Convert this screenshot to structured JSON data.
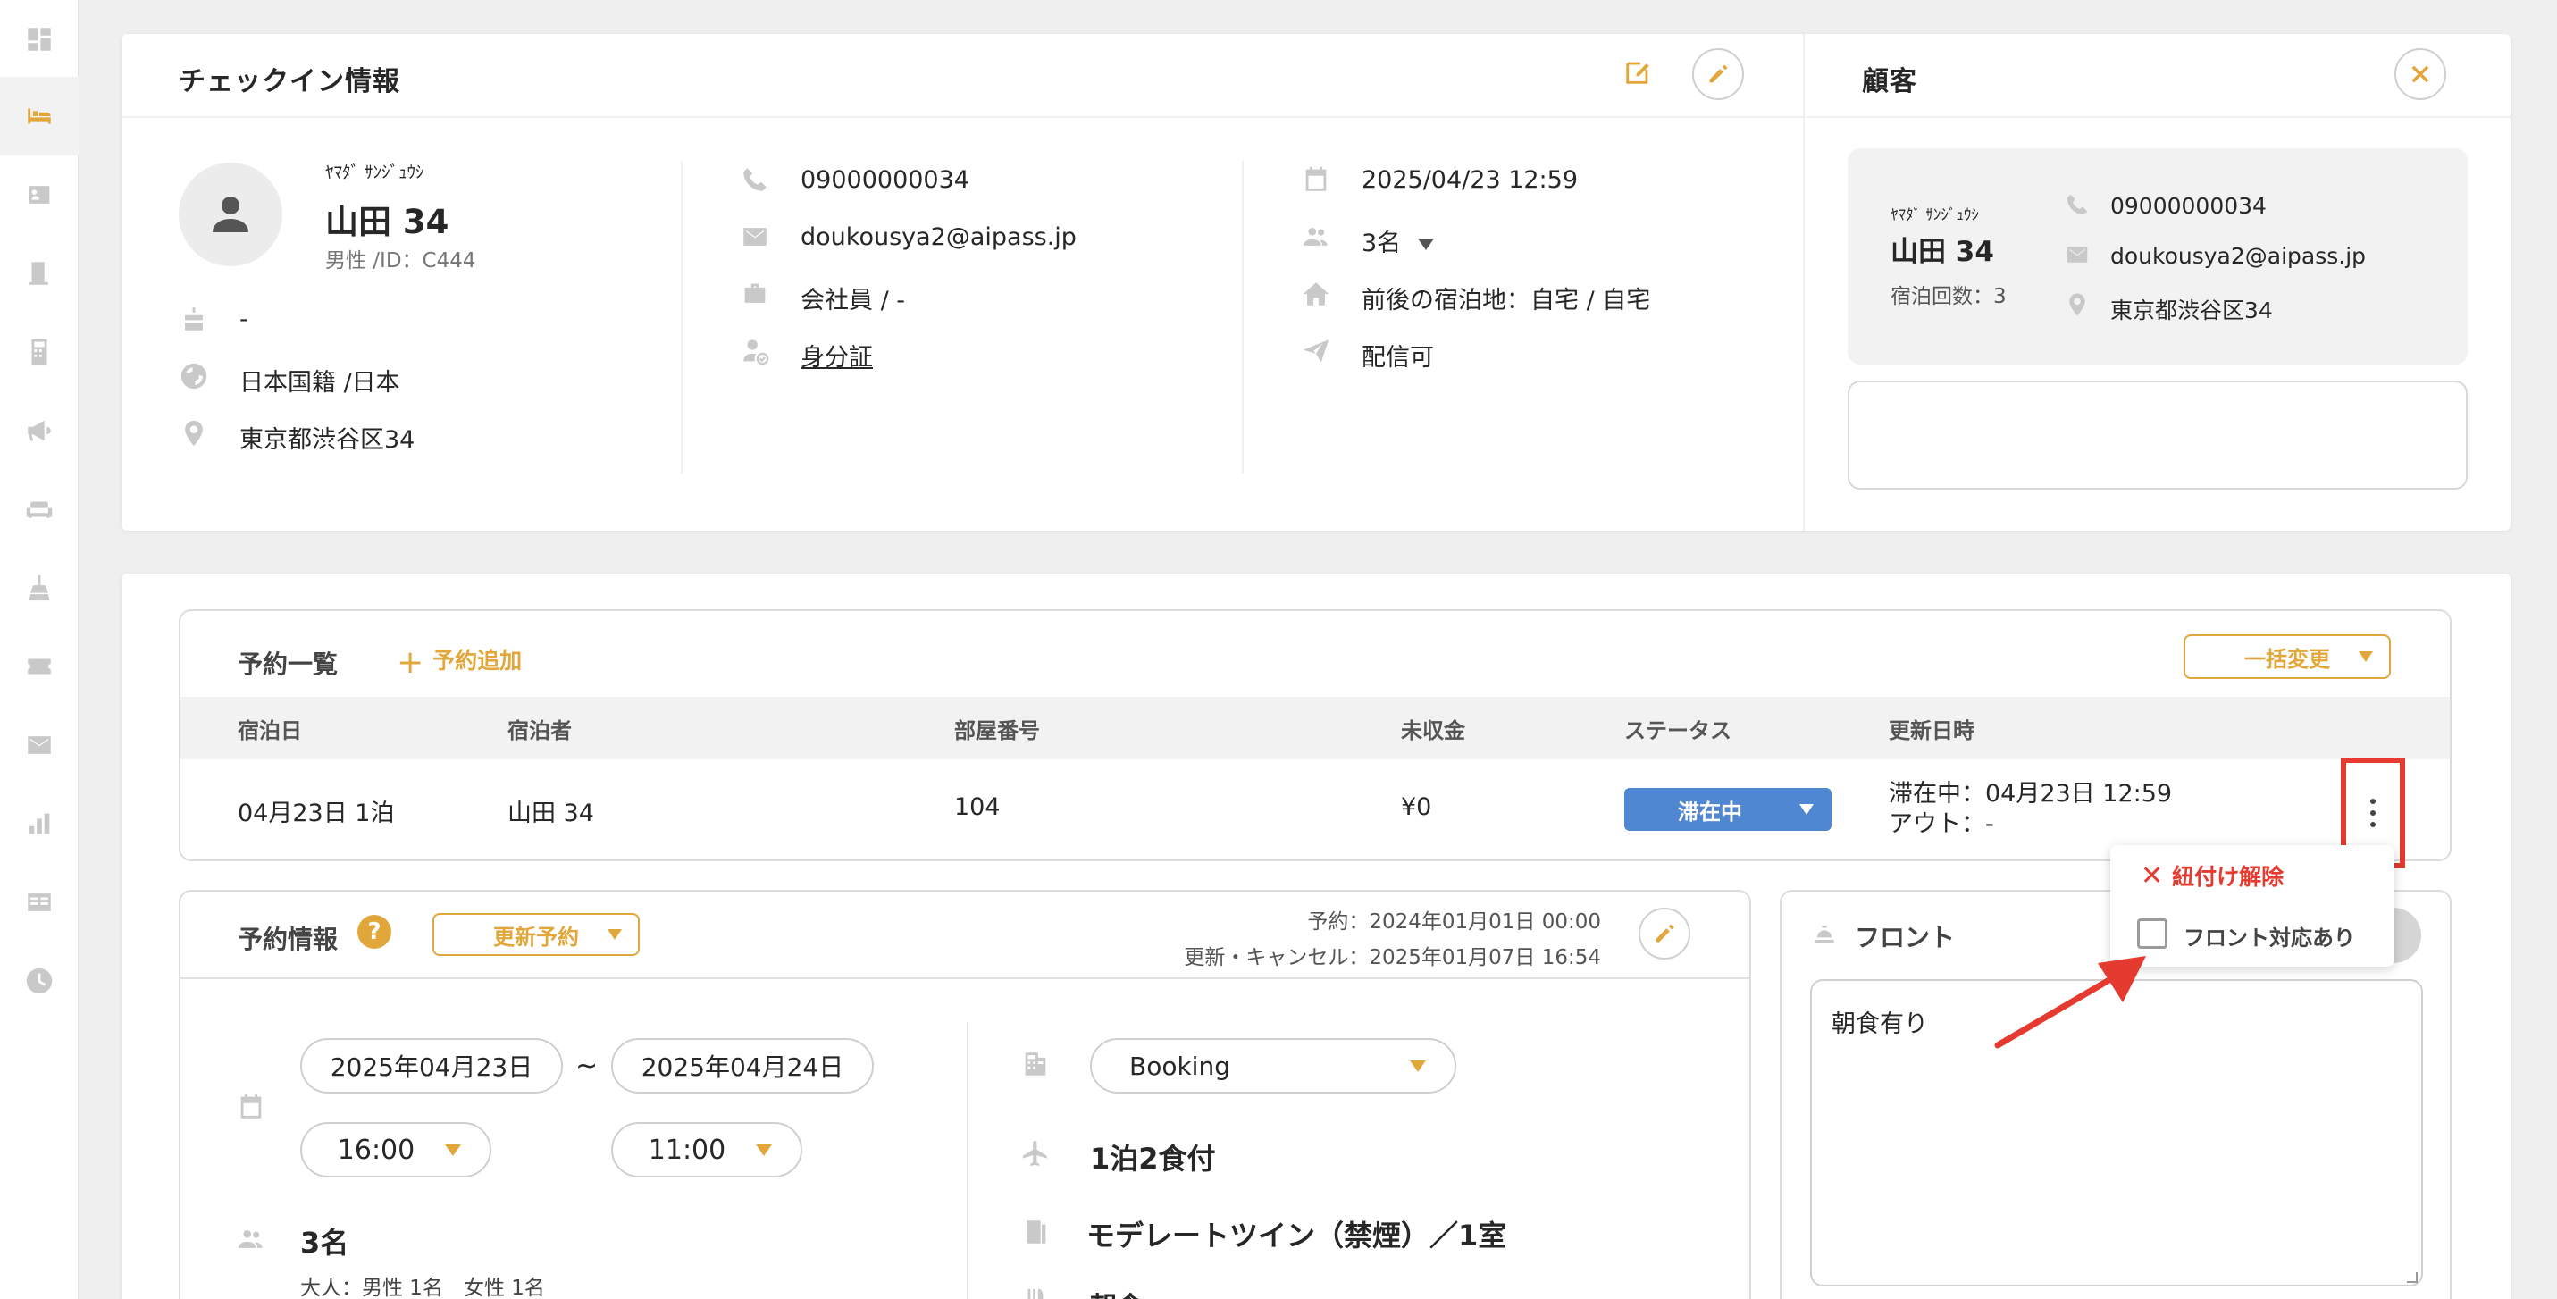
{
  "colors": {
    "accent": "#e2a73b",
    "status_blue": "#5087d3",
    "highlight_red": "#e43a2f"
  },
  "sidebar": {
    "icons": [
      "dashboard-icon",
      "bed-icon",
      "contact-card-icon",
      "door-icon",
      "calculator-icon",
      "megaphone-icon",
      "sofa-icon",
      "broom-icon",
      "ticket-icon",
      "mail-icon",
      "bar-chart-icon",
      "list-card-icon",
      "clock-icon"
    ],
    "active": "bed-icon"
  },
  "checkin": {
    "title": "チェックイン情報",
    "guest": {
      "kana": "ﾔﾏﾀﾞ ｻﾝｼﾞｭｳｼ",
      "name": "山田 34",
      "meta": "男性 /ID：C444",
      "birthday": "-",
      "nationality": "日本国籍 /日本",
      "address": "東京都渋谷区34"
    },
    "contact": {
      "phone": "09000000034",
      "email": "doukousya2@aipass.jp",
      "occupation": "会社員 / -",
      "id_doc": "身分証"
    },
    "stay": {
      "datetime": "2025/04/23 12:59",
      "people": "3名",
      "prev_next": "前後の宿泊地：自宅 / 自宅",
      "delivery": "配信可"
    }
  },
  "customer": {
    "title": "顧客",
    "kana": "ﾔﾏﾀﾞ ｻﾝｼﾞｭｳｼ",
    "name": "山田 34",
    "stays": "宿泊回数：3",
    "phone": "09000000034",
    "email": "doukousya2@aipass.jp",
    "address": "東京都渋谷区34"
  },
  "reservation_list": {
    "title": "予約一覧",
    "add_label": "予約追加",
    "bulk_label": "一括変更",
    "headers": [
      "宿泊日",
      "宿泊者",
      "部屋番号",
      "未収金",
      "ステータス",
      "更新日時"
    ],
    "row": {
      "date": "04月23日 1泊",
      "guest": "山田 34",
      "room": "104",
      "unpaid": "¥0",
      "status": "滞在中",
      "updated_line1": "滞在中：04月23日 12:59",
      "updated_line2": "アウト：-"
    }
  },
  "menu": {
    "unlink": "紐付け解除",
    "front_flag": "フロント対応あり"
  },
  "reservation_info": {
    "title": "予約情報",
    "update_select": "更新予約",
    "booked": "予約：2024年01月01日 00:00",
    "updated": "更新・キャンセル：2025年01月07日 16:54",
    "checkin_date": "2025年04月23日",
    "tilde": "~",
    "checkout_date": "2025年04月24日",
    "checkin_time": "16:00",
    "checkout_time": "11:00",
    "people": "3名",
    "people_detail": "大人：男性 1名　女性 1名",
    "channel": "Booking",
    "plan": "1泊2食付",
    "room_type": "モデレートツイン（禁煙）／1室",
    "extra": "朝食"
  },
  "front": {
    "title": "フロント",
    "memo": "朝食有り"
  }
}
